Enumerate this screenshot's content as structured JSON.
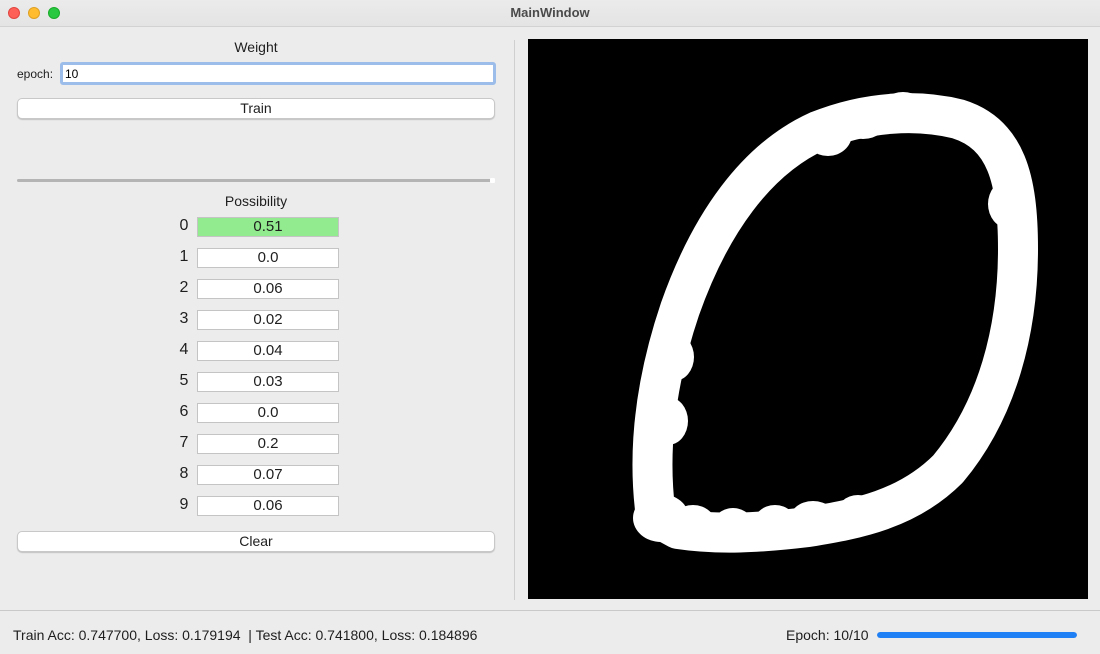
{
  "window": {
    "title": "MainWindow"
  },
  "weight": {
    "label": "Weight",
    "epoch_label": "epoch:",
    "epoch_value": "10"
  },
  "train_button": "Train",
  "slider": {
    "value": 1.0
  },
  "possibility": {
    "label": "Possibility",
    "items": [
      {
        "digit": "0",
        "value": "0.51"
      },
      {
        "digit": "1",
        "value": "0.0"
      },
      {
        "digit": "2",
        "value": "0.06"
      },
      {
        "digit": "3",
        "value": "0.02"
      },
      {
        "digit": "4",
        "value": "0.04"
      },
      {
        "digit": "5",
        "value": "0.03"
      },
      {
        "digit": "6",
        "value": "0.0"
      },
      {
        "digit": "7",
        "value": "0.2"
      },
      {
        "digit": "8",
        "value": "0.07"
      },
      {
        "digit": "9",
        "value": "0.06"
      }
    ],
    "highlight_color": "#92ec8f"
  },
  "clear_button": "Clear",
  "status": {
    "metrics": "Train Acc: 0.747700, Loss: 0.179194  | Test Acc: 0.741800, Loss: 0.184896",
    "epoch": "Epoch: 10/10",
    "progress": 1.0,
    "progress_color": "#1f80f5"
  },
  "canvas": {
    "background": "#000000",
    "stroke_color": "#ffffff"
  }
}
